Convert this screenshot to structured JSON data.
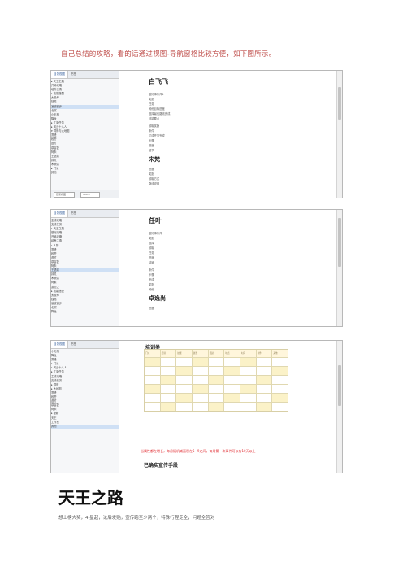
{
  "intro": "自己总结的攻略，看的话通过视图-导航窗格比较方便，如下图所示。",
  "tabs": [
    "目录视图",
    "书签"
  ],
  "zoom": "100%",
  "shots": [
    {
      "nav_items": [
        "▸ 天王之路",
        "  开局攻略",
        "  培养主角",
        "▸ 技能搭配",
        "  太极拳",
        "  独孤",
        "  凌波微步",
        "  北冥",
        "  小无相",
        "  降龙",
        "▸ 江湖任务",
        "▸ 风云十八人",
        "▾ 洞府与大地图",
        "  萧峰",
        "  段誉",
        "  虚竹",
        "  慕容复",
        "  阿朱",
        "  王语嫣",
        "  钟灵",
        "  木婉清",
        "▸ 门派",
        "  其他"
      ],
      "selected": 6,
      "doc": {
        "h1": "白飞飞",
        "lines1": [
          "做好事条件1",
          "奖励",
          "任务",
          "其他目标进度",
          "选择最佳路线完成",
          "技能要点"
        ],
        "lines2": [
          "领取奖励",
          "条件",
          "达成任务完成",
          "步骤",
          "进度",
          "细节"
        ],
        "h2": "宋梵",
        "lines3": [
          "进度",
          "奖励",
          "领取方式",
          "路线说明"
        ]
      }
    },
    {
      "nav_items": [
        "  主线攻略",
        "  支线任务",
        "▸ 天王之路",
        "  基础攻略",
        "  开局攻略",
        "  培养主角",
        "▸ 人物",
        "  萧峰",
        "  段誉",
        "  虚竹",
        "  慕容复",
        "  阿朱",
        "  王语嫣",
        "  钟灵",
        "  木婉清",
        "  阿紫",
        "  游坦之",
        "▸ 技能搭配",
        "  太极拳",
        "  独孤",
        "  凌波微步",
        "  北冥",
        "  降龙"
      ],
      "selected": 12,
      "doc": {
        "h1": "任叶",
        "lines1": [
          "做好事条件",
          "奖励",
          "选择",
          "领取",
          "任务",
          "进度",
          "结局"
        ],
        "lines2": [
          "条件",
          "步骤",
          "完成",
          "奖励",
          "其他"
        ],
        "h2": "卓逸尚",
        "lines3": [
          "进度"
        ]
      }
    },
    {
      "nav_items": [
        "  小无相",
        "  降龙",
        "  萧峰",
        "▸ 门派",
        "▸ 风云十八人",
        "▸ 江湖任务",
        "  主线攻略",
        "  支线任务",
        "▸ 洞府",
        "▸ 大地图",
        "  萧峰",
        "  段誉",
        "  虚竹",
        "  慕容复",
        "  阿朱",
        "▸ 秘籍",
        "  天王",
        "  工作室",
        "  其他"
      ],
      "selected": 18,
      "doc": {
        "h1": "培训类",
        "table_head": [
          "门派",
          "培训",
          "技能",
          "属性",
          "奖励",
          "地点",
          "时间",
          "条件",
          "其他"
        ],
        "table_rows": [
          [
            "",
            "",
            "",
            "",
            "",
            "",
            "",
            "",
            ""
          ],
          [
            "",
            "",
            "",
            "",
            "",
            "",
            "",
            "",
            ""
          ],
          [
            "",
            "",
            "",
            "",
            "",
            "",
            "",
            "",
            ""
          ],
          [
            "",
            "",
            "",
            "",
            "",
            "",
            "",
            "",
            ""
          ],
          [
            "",
            "",
            "",
            "",
            "",
            "",
            "",
            "",
            ""
          ],
          [
            "",
            "",
            "",
            "",
            "",
            "",
            "",
            "",
            ""
          ]
        ],
        "red": "当属性都在增长，每月随机减面积在5~9之间，每月第一次事件可以有10天以上",
        "h2": "已确实宣传手段"
      }
    }
  ],
  "bigtitle": "天王之路",
  "foot": "想上榜大奖，4 星起，论后发贴，宣传跑至少两个，特殊行程走全，问题全答对"
}
